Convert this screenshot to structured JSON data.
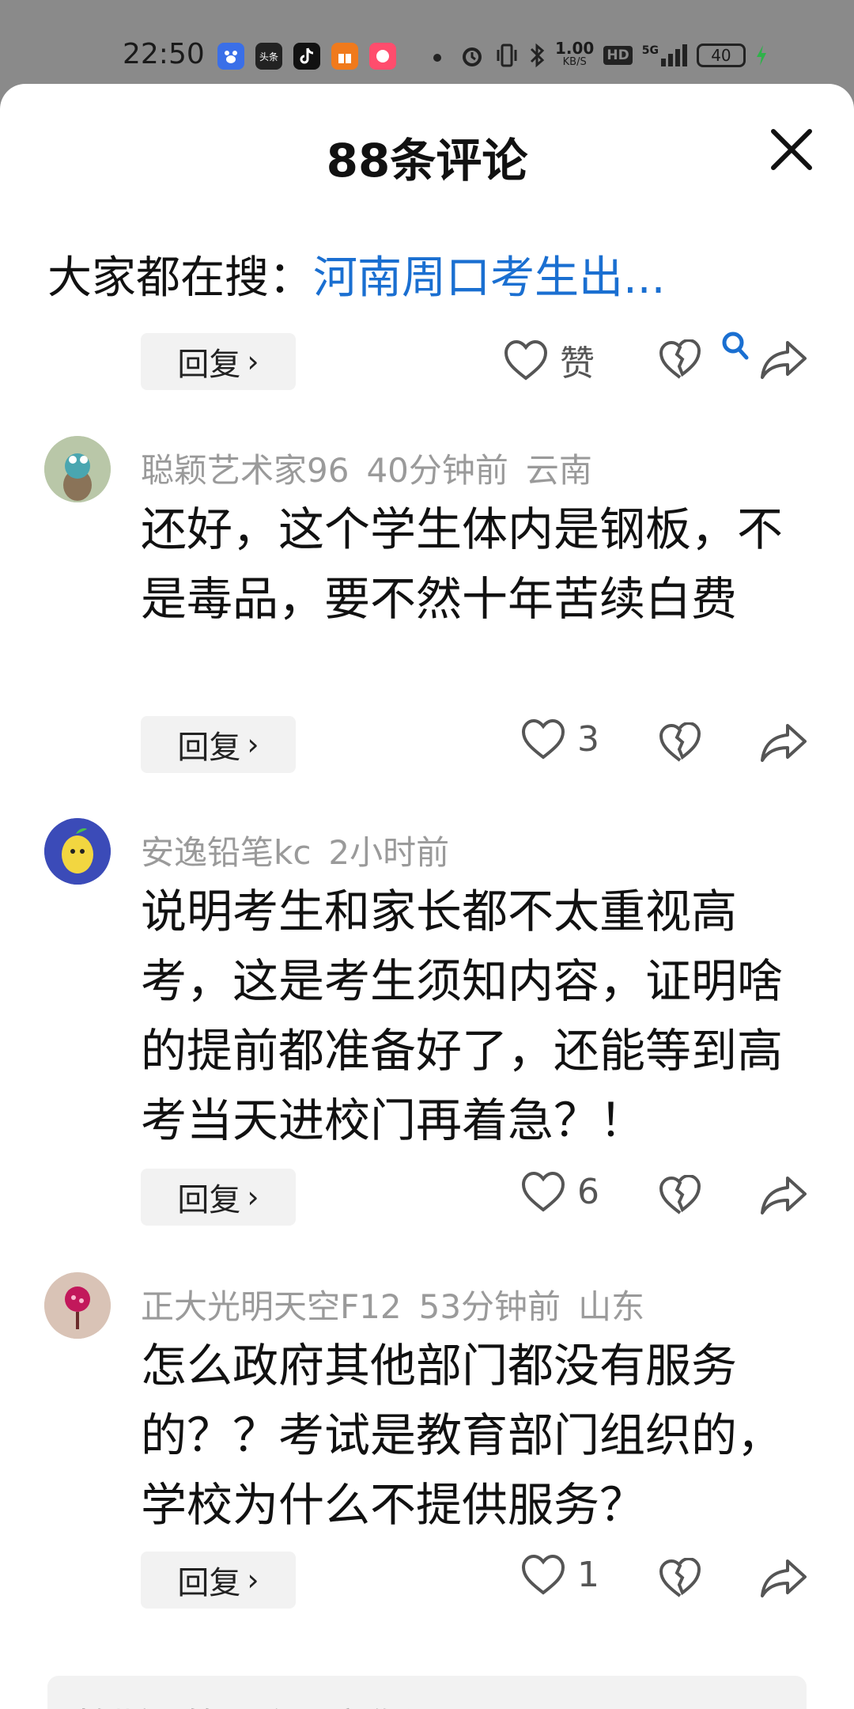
{
  "status_bar": {
    "time": "22:50",
    "app_icons": [
      "baidu-icon",
      "toutiao-icon",
      "douyin-icon",
      "gift-app-icon",
      "shopping-app-icon"
    ],
    "toutiao_label": "头条",
    "net_speed": "1.00",
    "net_speed_unit": "KB/S",
    "hd_label": "HD",
    "signal": "5G",
    "battery": "40"
  },
  "sheet": {
    "title": "88条评论"
  },
  "search": {
    "prefix": "大家都在搜：",
    "term": "河南周口考生出..."
  },
  "top_actions": {
    "reply_label": "回复",
    "like_label": "赞"
  },
  "comments": [
    {
      "username": "聪颖艺术家96",
      "time": "40分钟前",
      "location": "云南",
      "text": "还好，这个学生体内是钢板，不是毒品，要不然十年苦续白费",
      "reply_label": "回复",
      "likes": "3"
    },
    {
      "username": "安逸铅笔kc",
      "time": "2小时前",
      "location": "",
      "text": "说明考生和家长都不太重视高考，这是考生须知内容，证明啥的提前都准备好了，还能等到高考当天进校门再着急？！",
      "reply_label": "回复",
      "likes": "6"
    },
    {
      "username": "正大光明天空F12",
      "time": "53分钟前",
      "location": "山东",
      "text": "怎么政府其他部门都没有服务的？？考试是教育部门组织的，学校为什么不提供服务？",
      "reply_label": "回复",
      "likes": "1"
    }
  ],
  "bottom_input": {
    "placeholder": "恰斯一筐一个三字你还"
  },
  "colors": {
    "accent_link": "#1a6fd1",
    "meta_gray": "#9a9a9a",
    "overlay_gray": "#8a8a8a"
  }
}
